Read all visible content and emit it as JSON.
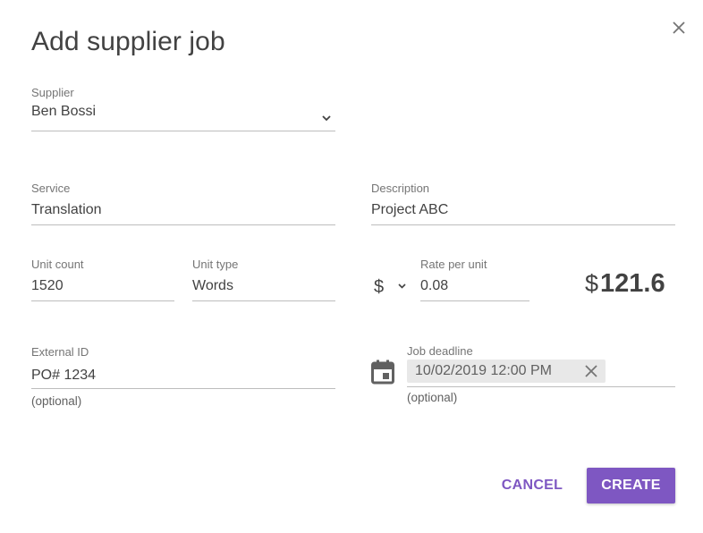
{
  "dialog": {
    "title": "Add supplier job",
    "close_icon": "close-icon"
  },
  "fields": {
    "supplier": {
      "label": "Supplier",
      "value": "Ben Bossi"
    },
    "service": {
      "label": "Service",
      "value": "Translation"
    },
    "description": {
      "label": "Description",
      "value": "Project ABC"
    },
    "unit_count": {
      "label": "Unit count",
      "value": "1520"
    },
    "unit_type": {
      "label": "Unit type",
      "value": "Words"
    },
    "currency": {
      "value": "$"
    },
    "rate_per_unit": {
      "label": "Rate per unit",
      "value": "0.08"
    },
    "total": {
      "symbol": "$",
      "amount": "121.6"
    },
    "external_id": {
      "label": "External ID",
      "value": "PO# 1234",
      "hint": "(optional)"
    },
    "job_deadline": {
      "label": "Job deadline",
      "value": "10/02/2019 12:00 PM",
      "hint": "(optional)"
    }
  },
  "actions": {
    "cancel": "CANCEL",
    "create": "CREATE"
  },
  "colors": {
    "accent": "#7e57c2",
    "text": "#424242",
    "label": "#757575",
    "underline": "#bdbdbd",
    "chip_bg": "#e8e8e8"
  },
  "icons": [
    "close-icon",
    "chevron-down-icon",
    "calendar-icon",
    "clear-icon"
  ]
}
